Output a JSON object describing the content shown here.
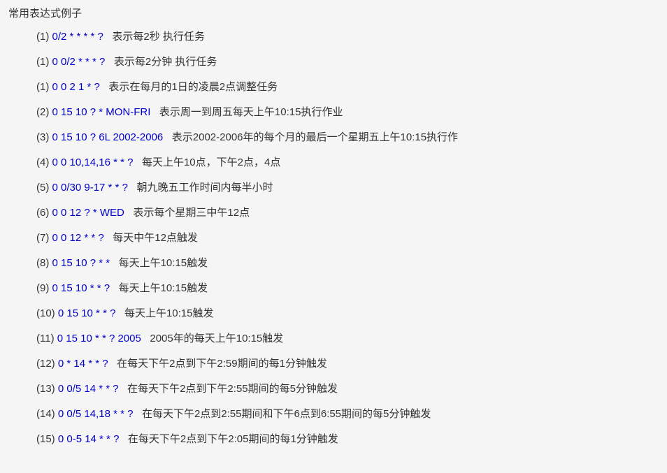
{
  "title": "常用表达式例子",
  "items": [
    {
      "num": "(1)",
      "expr": "0/2 * * * * ?",
      "desc": "表示每2秒 执行任务"
    },
    {
      "num": "(1)",
      "expr": "0 0/2 * * * ?",
      "desc": "表示每2分钟 执行任务"
    },
    {
      "num": "(1)",
      "expr": "0 0 2 1 * ?",
      "desc": "表示在每月的1日的凌晨2点调整任务"
    },
    {
      "num": "(2)",
      "expr": "0 15 10 ? * MON-FRI",
      "desc": "表示周一到周五每天上午10:15执行作业"
    },
    {
      "num": "(3)",
      "expr": "0 15 10 ? 6L 2002-2006",
      "desc": "表示2002-2006年的每个月的最后一个星期五上午10:15执行作"
    },
    {
      "num": "(4)",
      "expr": "0 0 10,14,16 * * ?",
      "desc": "每天上午10点，下午2点，4点"
    },
    {
      "num": "(5)",
      "expr": "0 0/30 9-17 * * ?",
      "desc": "朝九晚五工作时间内每半小时"
    },
    {
      "num": "(6)",
      "expr": "0 0 12 ? * WED",
      "desc": "表示每个星期三中午12点"
    },
    {
      "num": "(7)",
      "expr": "0 0 12 * * ?",
      "desc": "每天中午12点触发"
    },
    {
      "num": "(8)",
      "expr": "0 15 10 ? * *",
      "desc": "每天上午10:15触发"
    },
    {
      "num": "(9)",
      "expr": "0 15 10 * * ?",
      "desc": "每天上午10:15触发"
    },
    {
      "num": "(10)",
      "expr": "0 15 10 * * ?",
      "desc": "每天上午10:15触发"
    },
    {
      "num": "(11)",
      "expr": "0 15 10 * * ? 2005",
      "desc": "2005年的每天上午10:15触发"
    },
    {
      "num": "(12)",
      "expr": "0 * 14 * * ?",
      "desc": "在每天下午2点到下午2:59期间的每1分钟触发"
    },
    {
      "num": "(13)",
      "expr": "0 0/5 14 * * ?",
      "desc": "在每天下午2点到下午2:55期间的每5分钟触发"
    },
    {
      "num": "(14)",
      "expr": "0 0/5 14,18 * * ?",
      "desc": "在每天下午2点到2:55期间和下午6点到6:55期间的每5分钟触发"
    },
    {
      "num": "(15)",
      "expr": "0 0-5 14 * * ?",
      "desc": "在每天下午2点到下午2:05期间的每1分钟触发"
    }
  ]
}
